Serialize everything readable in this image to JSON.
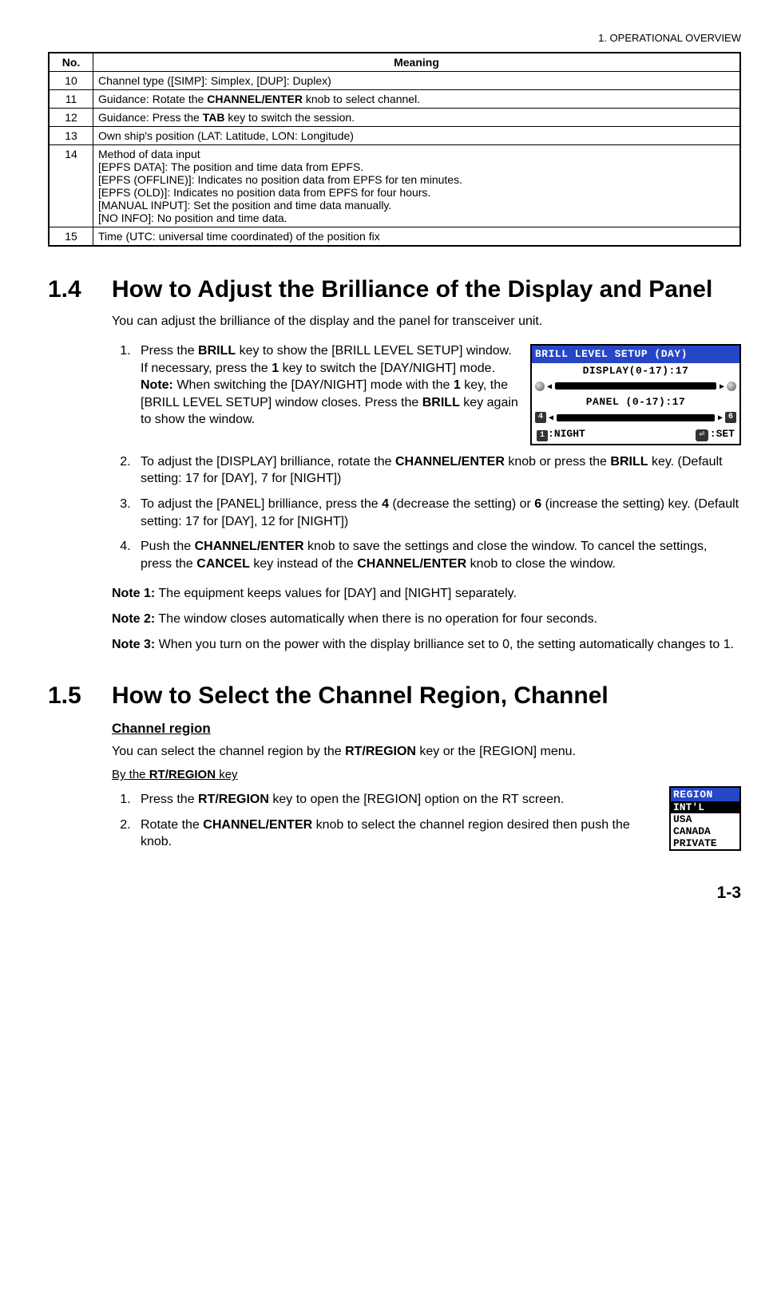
{
  "header": "1.  OPERATIONAL OVERVIEW",
  "table": {
    "col1": "No.",
    "col2": "Meaning",
    "rows": [
      {
        "no": "10",
        "text": "Channel type ([SIMP]: Simplex, [DUP]: Duplex)"
      },
      {
        "no": "11",
        "text_pre": "Guidance: Rotate the ",
        "bold": "CHANNEL/ENTER",
        "text_post": " knob to select channel."
      },
      {
        "no": "12",
        "text_pre": "Guidance: Press the ",
        "bold": "TAB",
        "text_post": " key to switch the session."
      },
      {
        "no": "13",
        "text": "Own ship's position (LAT: Latitude, LON: Longitude)"
      },
      {
        "no": "14",
        "lines": [
          "Method of data input",
          "[EPFS DATA]: The position and time data from EPFS.",
          "[EPFS (OFFLINE)]: Indicates no position data from EPFS for ten minutes.",
          "[EPFS (OLD)]: Indicates no position data from EPFS for four hours.",
          "[MANUAL INPUT]: Set the position and time data manually.",
          "[NO INFO]: No position and time data."
        ]
      },
      {
        "no": "15",
        "text": "Time (UTC: universal time coordinated) of the position fix"
      }
    ]
  },
  "sec14": {
    "num": "1.4",
    "title": "How to Adjust the Brilliance of the Display and Panel",
    "intro": "You can adjust the brilliance of the display and the panel for transceiver unit.",
    "step1": {
      "a1": "Press the ",
      "b1": "BRILL",
      "a2": " key to show the [BRILL LEVEL SETUP] window.",
      "a3": "If necessary, press the ",
      "b2": "1",
      "a4": " key to switch the [DAY/NIGHT] mode.",
      "nb": "Note:",
      "a5": " When switching the [DAY/NIGHT] mode with the ",
      "b3": "1",
      "a6": " key, the [BRILL LEVEL SETUP] window closes. Press the ",
      "b4": "BRILL",
      "a7": " key again to show the window."
    },
    "step2": {
      "a1": "To adjust the [DISPLAY] brilliance, rotate the ",
      "b1": "CHANNEL/ENTER",
      "a2": " knob or press the ",
      "b2": "BRILL",
      "a3": " key. (Default setting: 17 for [DAY], 7 for [NIGHT])"
    },
    "step3": {
      "a1": "To adjust the [PANEL] brilliance, press the ",
      "b1": "4",
      "a2": " (decrease the setting) or ",
      "b2": "6",
      "a3": " (increase the setting) key. (Default setting: 17 for [DAY], 12 for [NIGHT])"
    },
    "step4": {
      "a1": "Push the ",
      "b1": "CHANNEL/ENTER",
      "a2": " knob to save the settings and close the window. To cancel the settings, press the ",
      "b2": "CANCEL",
      "a3": " key instead of the ",
      "b3": "CHANNEL/ENTER",
      "a4": " knob to close the window."
    },
    "note1": {
      "lbl": "Note 1:",
      "txt": " The equipment keeps values for [DAY] and [NIGHT] separately."
    },
    "note2": {
      "lbl": "Note 2:",
      "txt": " The window closes automatically when there is no operation for four seconds."
    },
    "note3": {
      "lbl": "Note 3:",
      "txt": " When you turn on the power with the display brilliance set to 0, the setting automatically changes to 1."
    }
  },
  "brill": {
    "title": "BRILL LEVEL SETUP (DAY)",
    "disp_label": "DISPLAY(0-17):17",
    "panel_label": "PANEL  (0-17):17",
    "key4": "4",
    "key6": "6",
    "key1": "1",
    "left_bottom": ":NIGHT",
    "right_bottom": ":SET"
  },
  "sec15": {
    "num": "1.5",
    "title": "How to Select the Channel Region, Channel",
    "sub": "Channel region",
    "intro_a": "You can select the channel region by the ",
    "intro_b": "RT/REGION",
    "intro_c": " key or the [REGION] menu.",
    "method_a": "By the ",
    "method_b": "RT/REGION",
    "method_c": " key",
    "step1": {
      "a1": "Press the ",
      "b1": "RT/REGION",
      "a2": " key to open the [REGION] option on the RT screen."
    },
    "step2": {
      "a1": "Rotate the ",
      "b1": "CHANNEL/ENTER",
      "a2": " knob to select the channel region desired then push the knob."
    }
  },
  "region": {
    "title": "REGION",
    "items": [
      "INT'L",
      "USA",
      "CANADA",
      "PRIVATE"
    ]
  },
  "pagenum": "1-3"
}
